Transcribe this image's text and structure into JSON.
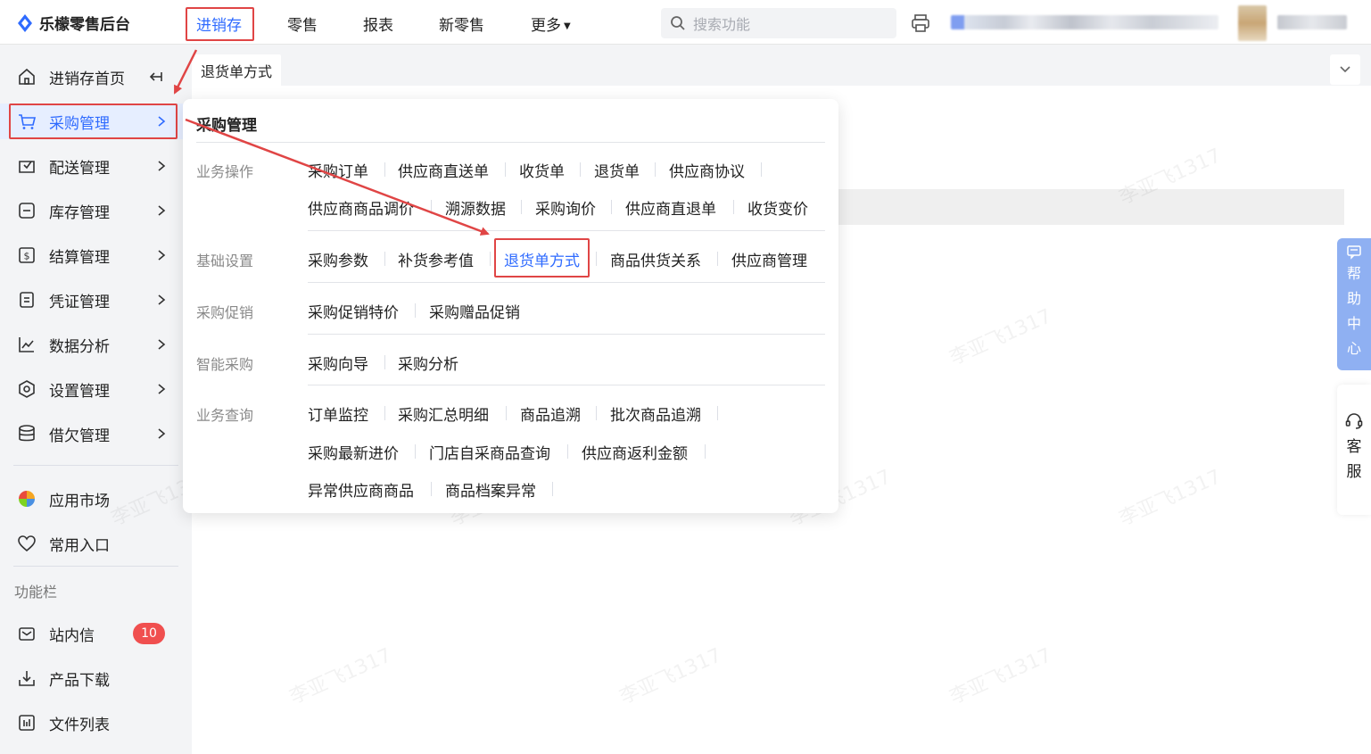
{
  "app": {
    "title": "乐檬零售后台"
  },
  "topnav": {
    "items": [
      {
        "label": "进销存",
        "active": true
      },
      {
        "label": "零售"
      },
      {
        "label": "报表"
      },
      {
        "label": "新零售"
      },
      {
        "label": "更多"
      }
    ],
    "search_placeholder": "搜索功能"
  },
  "sidebar": {
    "top_items": [
      {
        "label": "进销存首页",
        "icon": "home-icon"
      },
      {
        "label": "采购管理",
        "icon": "cart-icon",
        "active": true
      },
      {
        "label": "配送管理",
        "icon": "delivery-icon"
      },
      {
        "label": "库存管理",
        "icon": "inventory-icon"
      },
      {
        "label": "结算管理",
        "icon": "settlement-icon"
      },
      {
        "label": "凭证管理",
        "icon": "voucher-icon"
      },
      {
        "label": "数据分析",
        "icon": "chart-icon"
      },
      {
        "label": "设置管理",
        "icon": "settings-icon"
      },
      {
        "label": "借欠管理",
        "icon": "debt-icon"
      }
    ],
    "mid_items": [
      {
        "label": "应用市场",
        "icon": "app-market-icon"
      },
      {
        "label": "常用入口",
        "icon": "heart-icon"
      }
    ],
    "section_label": "功能栏",
    "bottom_items": [
      {
        "label": "站内信",
        "icon": "mail-icon",
        "badge": "10"
      },
      {
        "label": "产品下载",
        "icon": "download-icon"
      },
      {
        "label": "文件列表",
        "icon": "file-list-icon"
      }
    ]
  },
  "tabs": {
    "current": "退货单方式"
  },
  "help": {
    "label": [
      "帮",
      "助",
      "中",
      "心"
    ]
  },
  "service": {
    "label": [
      "客",
      "服"
    ]
  },
  "mega": {
    "title": "采购管理",
    "groups": {
      "g1": "业务操作",
      "g2": "基础设置",
      "g3": "采购促销",
      "g4": "智能采购",
      "g5": "业务查询"
    },
    "links": {
      "l1": "采购订单",
      "l2": "供应商直送单",
      "l3": "收货单",
      "l4": "退货单",
      "l5": "供应商协议",
      "l6": "供应商商品调价",
      "l7": "溯源数据",
      "l8": "采购询价",
      "l9": "供应商直退单",
      "l10": "收货变价",
      "l11": "采购参数",
      "l12": "补货参考值",
      "l13": "退货单方式",
      "l14": "商品供货关系",
      "l15": "供应商管理",
      "l16": "采购促销特价",
      "l17": "采购赠品促销",
      "l18": "采购向导",
      "l19": "采购分析",
      "l20": "订单监控",
      "l21": "采购汇总明细",
      "l22": "商品追溯",
      "l23": "批次商品追溯",
      "l24": "采购最新进价",
      "l25": "门店自采商品查询",
      "l26": "供应商返利金额",
      "l27": "异常供应商商品",
      "l28": "商品档案异常"
    }
  },
  "watermark": "李亚飞1317",
  "colors": {
    "accent": "#2f6bff",
    "highlight": "#e04545"
  }
}
